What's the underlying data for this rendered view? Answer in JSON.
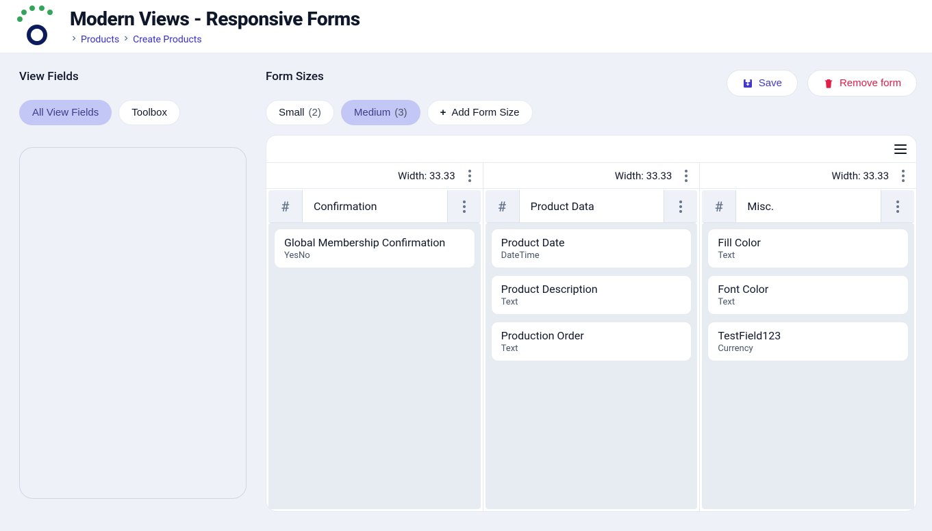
{
  "header": {
    "title": "Modern Views - Responsive Forms",
    "breadcrumb": [
      "Products",
      "Create Products"
    ]
  },
  "sidebar": {
    "title": "View Fields",
    "tabs": [
      {
        "label": "All View Fields",
        "active": true
      },
      {
        "label": "Toolbox",
        "active": false
      }
    ]
  },
  "actions": {
    "save": "Save",
    "remove": "Remove form"
  },
  "form_sizes": {
    "title": "Form Sizes",
    "sizes": [
      {
        "label": "Small",
        "count": "(2)",
        "active": false
      },
      {
        "label": "Medium",
        "count": "(3)",
        "active": true
      }
    ],
    "add_label": "Add Form Size"
  },
  "width_prefix": "Width: ",
  "columns": [
    {
      "width": "33.33",
      "title": "Confirmation",
      "fields": [
        {
          "name": "Global Membership Confirmation",
          "type": "YesNo"
        }
      ]
    },
    {
      "width": "33.33",
      "title": "Product Data",
      "fields": [
        {
          "name": "Product Date",
          "type": "DateTime"
        },
        {
          "name": "Product Description",
          "type": "Text"
        },
        {
          "name": "Production Order",
          "type": "Text"
        }
      ]
    },
    {
      "width": "33.33",
      "title": "Misc.",
      "fields": [
        {
          "name": "Fill Color",
          "type": "Text"
        },
        {
          "name": "Font Color",
          "type": "Text"
        },
        {
          "name": "TestField123",
          "type": "Currency"
        }
      ]
    }
  ]
}
